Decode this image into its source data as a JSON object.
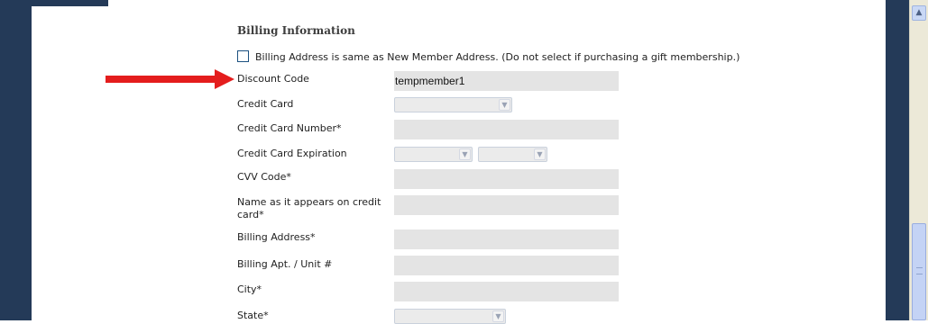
{
  "section_title": "Billing Information",
  "checkbox": {
    "label": "Billing Address is same as New Member Address. (Do not select if purchasing a gift membership.)",
    "checked": false
  },
  "fields": {
    "discount_code": {
      "label": "Discount Code",
      "value": "tempmember1"
    },
    "credit_card": {
      "label": "Credit Card",
      "value": ""
    },
    "credit_card_number": {
      "label": "Credit Card Number*",
      "value": ""
    },
    "credit_card_expiration": {
      "label": "Credit Card Expiration",
      "month": "",
      "year": ""
    },
    "cvv_code": {
      "label": "CVV Code*",
      "value": ""
    },
    "name_on_card": {
      "label": "Name as it appears on credit card*",
      "value": ""
    },
    "billing_address": {
      "label": "Billing Address*",
      "value": ""
    },
    "billing_apt": {
      "label": "Billing Apt. / Unit #",
      "value": ""
    },
    "city": {
      "label": "City*",
      "value": ""
    },
    "state": {
      "label": "State*",
      "value": ""
    }
  },
  "icons": {
    "annotation": "red-arrow-icon",
    "dropdown": "chevron-down-icon",
    "scroll_up": "chevron-up-icon"
  },
  "colors": {
    "frame": "#243a58",
    "arrow": "#e41d1d",
    "input_bg": "#e4e4e4"
  }
}
